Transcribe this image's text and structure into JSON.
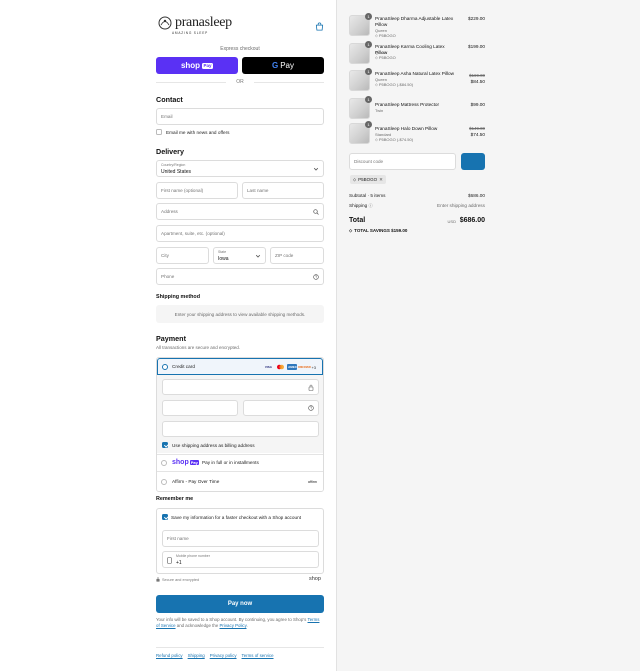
{
  "brand": {
    "name": "pranasleep",
    "tagline": "AMAZING SLEEP"
  },
  "express": {
    "label": "Express checkout",
    "shop_pay": "shop",
    "shop_pay_badge": "Pay",
    "gpay": "Pay",
    "gpay_g": "G",
    "or": "OR"
  },
  "contact": {
    "heading": "Contact",
    "email_placeholder": "Email",
    "newsletter_label": "Email me with news and offers"
  },
  "delivery": {
    "heading": "Delivery",
    "country_label": "Country/Region",
    "country_value": "United States",
    "first_name": "First name (optional)",
    "last_name": "Last name",
    "address": "Address",
    "apartment": "Apartment, suite, etc. (optional)",
    "city": "City",
    "state_label": "State",
    "state_value": "Iowa",
    "zip": "ZIP code",
    "phone": "Phone"
  },
  "shipping": {
    "heading": "Shipping method",
    "notice": "Enter your shipping address to view available shipping methods."
  },
  "payment": {
    "heading": "Payment",
    "subtitle": "All transactions are secure and encrypted.",
    "credit_card_label": "Credit card",
    "cards": [
      "VISA",
      "MC",
      "AMEX",
      "DISCOVER"
    ],
    "more_cards": "+3",
    "billing_label": "Use shipping address as billing address",
    "shoppay_label": "Pay in full or in installments",
    "shoppay_brand": "shop",
    "shoppay_badge": "Pay",
    "affirm_label": "Affirm - Pay Over Time",
    "affirm_logo": "affirm"
  },
  "remember": {
    "heading": "Remember me",
    "save_label": "Save my information for a faster checkout with a Shop account",
    "first_name": "First name",
    "mobile_label": "Mobile phone number",
    "mobile_value": "+1",
    "secure": "Secure and encrypted",
    "shop_logo": "shop"
  },
  "pay_now": "Pay now",
  "fine_print": {
    "text": "Your info will be saved to a Shop account. By continuing, you agree to Shop’s",
    "terms": "Terms of Service",
    "and": "and acknowledge the",
    "privacy": "Privacy Policy",
    "end": "."
  },
  "footer": [
    "Refund policy",
    "Shipping",
    "Privacy policy",
    "Terms of service"
  ],
  "cart": {
    "items": [
      {
        "qty": "1",
        "name": "PranaSleep Dharma Adjustable Latex Pillow",
        "variant": "Queen",
        "discount": "P5BOGO",
        "price": "$229.00",
        "orig": ""
      },
      {
        "qty": "1",
        "name": "PranaSleep Karma Cooling Latex Pillow",
        "variant": "Queen",
        "discount": "P5BOGO",
        "price": "$199.00",
        "orig": ""
      },
      {
        "qty": "1",
        "name": "PranaSleep Asha Natural Latex Pillow",
        "variant": "Queen",
        "discount": "P5BOGO (-$84.50)",
        "price": "$84.50",
        "orig": "$169.00"
      },
      {
        "qty": "1",
        "name": "PranaSleep Mattress Protector",
        "variant": "Twin",
        "discount": "",
        "price": "$99.00",
        "orig": ""
      },
      {
        "qty": "1",
        "name": "PranaSleep Halo Down Pillow",
        "variant": "Standard",
        "discount": "P5BOGO (-$74.50)",
        "price": "$74.50",
        "orig": "$149.00"
      }
    ],
    "discount_placeholder": "Discount code",
    "applied_code": "P5BOGO",
    "subtotal_label": "Subtotal · 5 items",
    "subtotal": "$686.00",
    "shipping_label": "Shipping",
    "shipping_value": "Enter shipping address",
    "total_label": "Total",
    "currency": "USD",
    "total": "$686.00",
    "savings": "TOTAL SAVINGS $159.00"
  },
  "colors": {
    "accent": "#1773b0",
    "shop_purple": "#5a31f4"
  }
}
